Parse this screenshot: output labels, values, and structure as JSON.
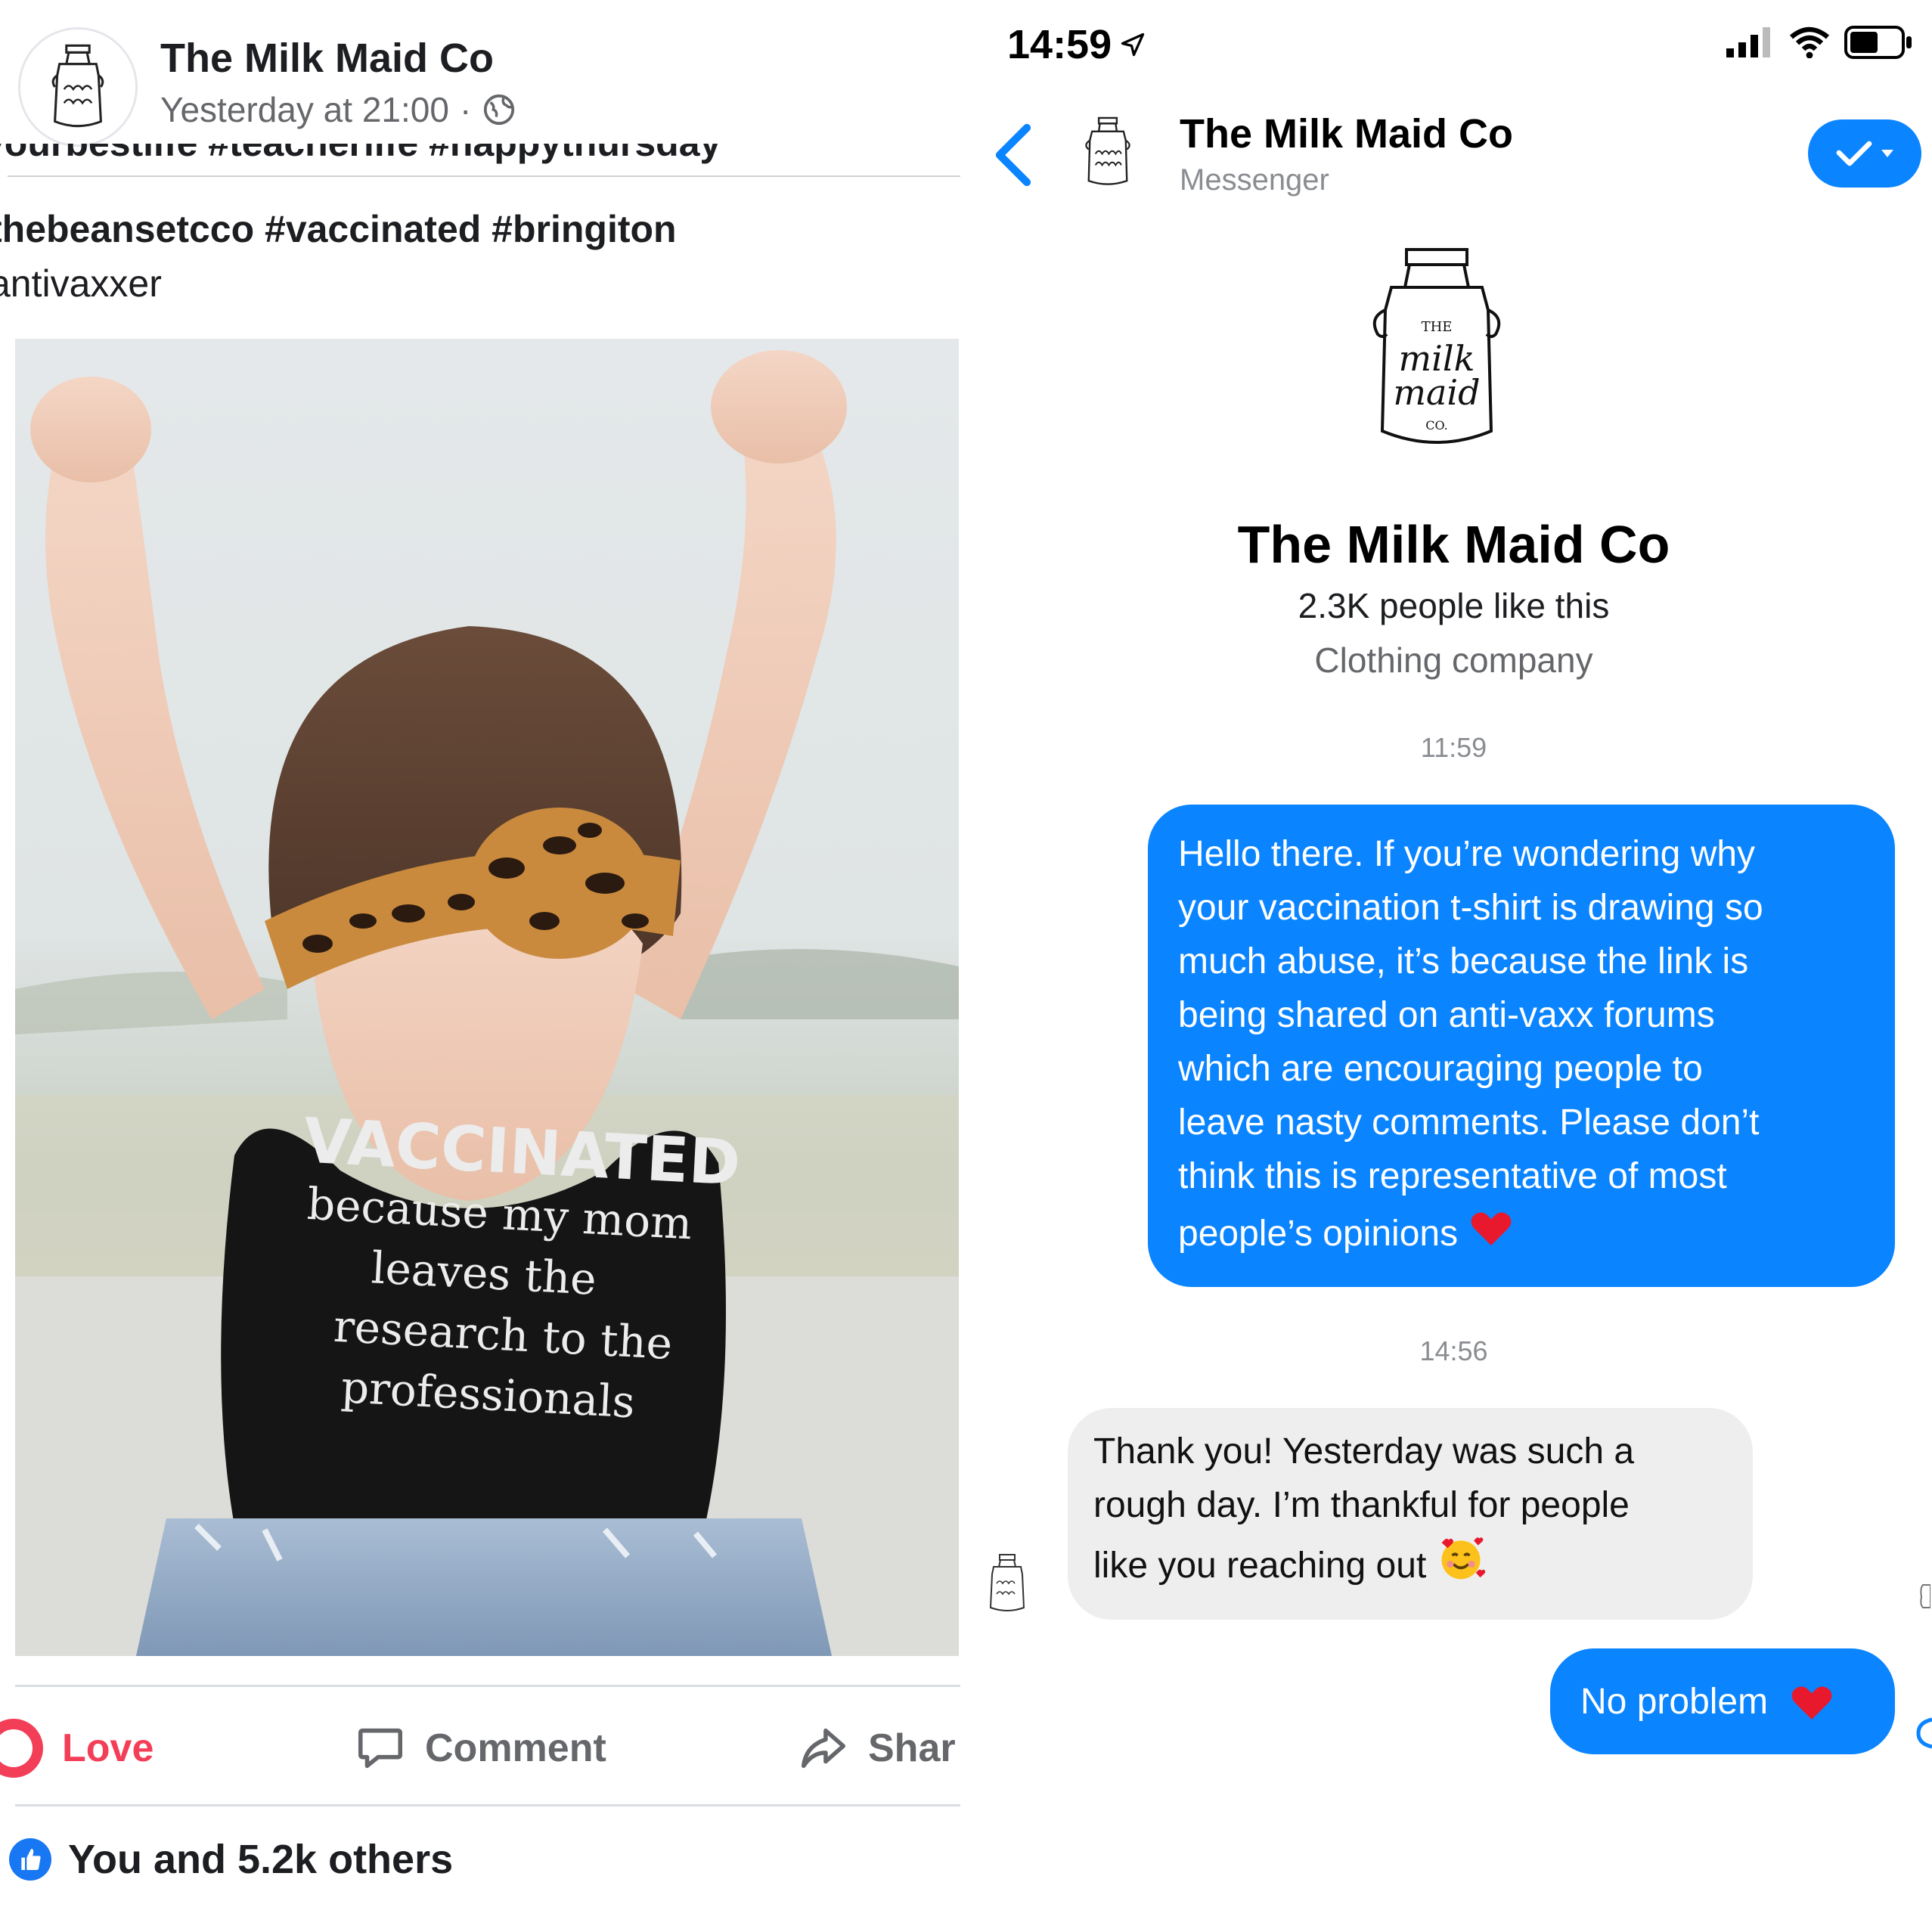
{
  "facebook_post": {
    "page_name": "The Milk Maid Co",
    "posted_time": "Yesterday at 21:00",
    "meta_separator": "·",
    "caption_lines": [
      "yourbestlife #teacherlife #happythursday",
      "thebeansetcco #vaccinated #bringiton",
      "antivaxxer"
    ],
    "shirt_text": {
      "line1": "VACCINATED",
      "line2": "because my mom",
      "line3": "leaves the",
      "line4": "research to the",
      "line5": "professionals"
    },
    "actions": {
      "love_label": "Love",
      "comment_label": "Comment",
      "share_label": "Shar"
    },
    "reactions_text": "You and 5.2k others",
    "icons": [
      "globe-icon",
      "love-icon",
      "comment-icon",
      "share-icon",
      "like-icon"
    ],
    "colors": {
      "love": "#f33e58",
      "like": "#1877f2",
      "muted": "#65676b"
    }
  },
  "messenger": {
    "status_bar": {
      "time": "14:59",
      "icons": [
        "location-arrow-icon",
        "signal-icon",
        "wifi-icon",
        "battery-icon"
      ]
    },
    "header": {
      "name": "The Milk Maid Co",
      "subtitle": "Messenger"
    },
    "profile": {
      "logo_text_top": "THE",
      "logo_text_main1": "milk",
      "logo_text_main2": "maid",
      "logo_text_bottom": "CO.",
      "name": "The Milk Maid Co",
      "likes": "2.3K people like this",
      "category": "Clothing company"
    },
    "messages": [
      {
        "timestamp": "11:59",
        "direction": "outgoing",
        "lines": [
          "Hello there. If you’re wondering why",
          "your vaccination t-shirt is drawing so",
          "much abuse, it’s because the link is",
          "being shared on anti-vaxx forums",
          "which are encouraging people to",
          "leave nasty comments. Please don’t",
          "think this is representative of most",
          "people’s opinions"
        ],
        "emoji": "red-heart-icon"
      },
      {
        "timestamp": "14:56",
        "direction": "incoming",
        "lines": [
          "Thank you! Yesterday was such a",
          "rough day. I’m thankful for people",
          "like you reaching out"
        ],
        "emoji": "smiling-face-with-hearts-icon"
      },
      {
        "direction": "outgoing",
        "text": "No problem",
        "emoji": "red-heart-icon"
      }
    ],
    "colors": {
      "accent": "#0a84ff",
      "incoming_bubble": "#eeeeef",
      "timestamp": "#8a8d91"
    }
  }
}
